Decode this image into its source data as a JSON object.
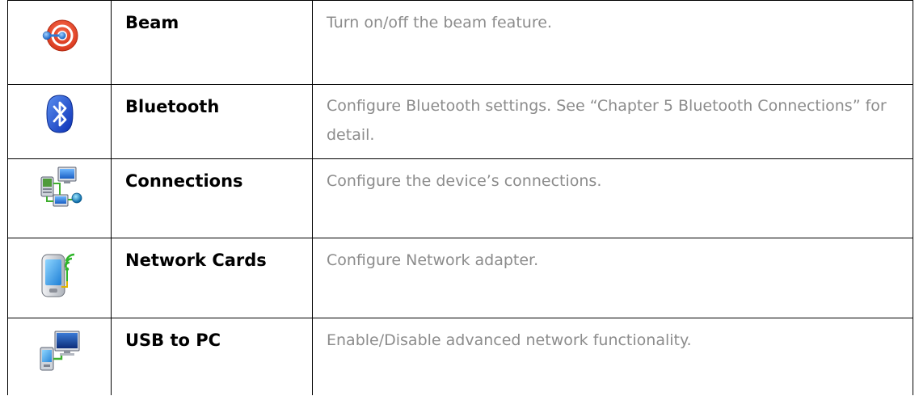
{
  "rows": [
    {
      "icon": "beam-icon",
      "name": "Beam",
      "description": "Turn on/off the beam feature."
    },
    {
      "icon": "bluetooth-icon",
      "name": "Bluetooth",
      "description": "Configure Bluetooth settings. See “Chapter 5 Bluetooth Connections” for detail."
    },
    {
      "icon": "connections-icon",
      "name": "Connections",
      "description": "Configure the device’s connections."
    },
    {
      "icon": "network-cards-icon",
      "name": "Network Cards",
      "description": "Configure Network adapter."
    },
    {
      "icon": "usb-to-pc-icon",
      "name": "USB to PC",
      "description": "Enable/Disable advanced network functionality."
    }
  ],
  "colors": {
    "name_text": "#000000",
    "description_text": "#8c8c8c",
    "border": "#000000"
  }
}
